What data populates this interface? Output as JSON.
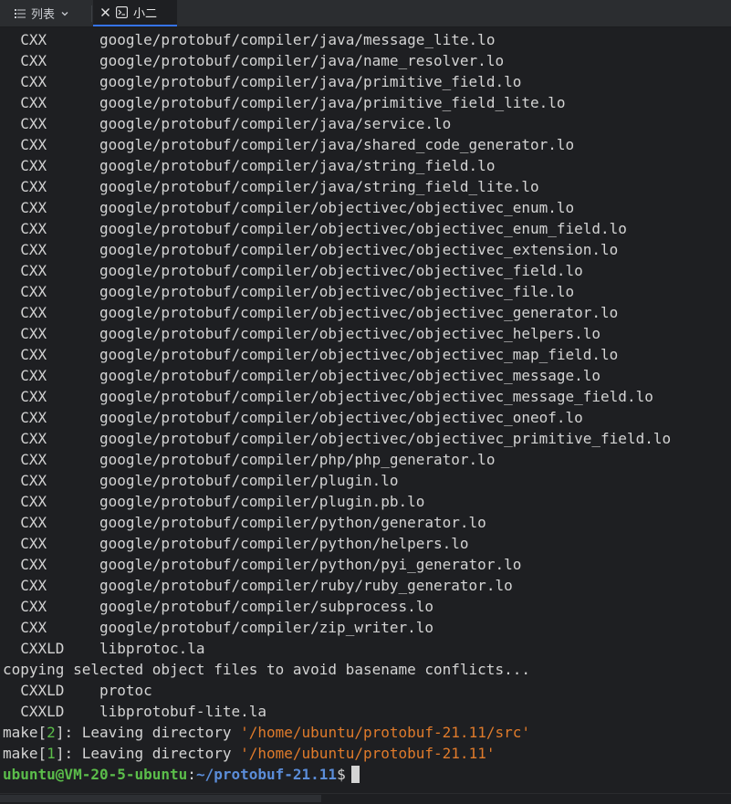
{
  "tabs": {
    "list_label": "列表",
    "active_label": "小二"
  },
  "colors": {
    "background": "#1e1f22",
    "text": "#d4d4d4",
    "orange": "#e07b2b",
    "green": "#5bbd4a",
    "blue": "#5b8dd9"
  },
  "build_lines": [
    {
      "tool": "CXX",
      "path": "google/protobuf/compiler/java/message_lite.lo"
    },
    {
      "tool": "CXX",
      "path": "google/protobuf/compiler/java/name_resolver.lo"
    },
    {
      "tool": "CXX",
      "path": "google/protobuf/compiler/java/primitive_field.lo"
    },
    {
      "tool": "CXX",
      "path": "google/protobuf/compiler/java/primitive_field_lite.lo"
    },
    {
      "tool": "CXX",
      "path": "google/protobuf/compiler/java/service.lo"
    },
    {
      "tool": "CXX",
      "path": "google/protobuf/compiler/java/shared_code_generator.lo"
    },
    {
      "tool": "CXX",
      "path": "google/protobuf/compiler/java/string_field.lo"
    },
    {
      "tool": "CXX",
      "path": "google/protobuf/compiler/java/string_field_lite.lo"
    },
    {
      "tool": "CXX",
      "path": "google/protobuf/compiler/objectivec/objectivec_enum.lo"
    },
    {
      "tool": "CXX",
      "path": "google/protobuf/compiler/objectivec/objectivec_enum_field.lo"
    },
    {
      "tool": "CXX",
      "path": "google/protobuf/compiler/objectivec/objectivec_extension.lo"
    },
    {
      "tool": "CXX",
      "path": "google/protobuf/compiler/objectivec/objectivec_field.lo"
    },
    {
      "tool": "CXX",
      "path": "google/protobuf/compiler/objectivec/objectivec_file.lo"
    },
    {
      "tool": "CXX",
      "path": "google/protobuf/compiler/objectivec/objectivec_generator.lo"
    },
    {
      "tool": "CXX",
      "path": "google/protobuf/compiler/objectivec/objectivec_helpers.lo"
    },
    {
      "tool": "CXX",
      "path": "google/protobuf/compiler/objectivec/objectivec_map_field.lo"
    },
    {
      "tool": "CXX",
      "path": "google/protobuf/compiler/objectivec/objectivec_message.lo"
    },
    {
      "tool": "CXX",
      "path": "google/protobuf/compiler/objectivec/objectivec_message_field.lo"
    },
    {
      "tool": "CXX",
      "path": "google/protobuf/compiler/objectivec/objectivec_oneof.lo"
    },
    {
      "tool": "CXX",
      "path": "google/protobuf/compiler/objectivec/objectivec_primitive_field.lo"
    },
    {
      "tool": "CXX",
      "path": "google/protobuf/compiler/php/php_generator.lo"
    },
    {
      "tool": "CXX",
      "path": "google/protobuf/compiler/plugin.lo"
    },
    {
      "tool": "CXX",
      "path": "google/protobuf/compiler/plugin.pb.lo"
    },
    {
      "tool": "CXX",
      "path": "google/protobuf/compiler/python/generator.lo"
    },
    {
      "tool": "CXX",
      "path": "google/protobuf/compiler/python/helpers.lo"
    },
    {
      "tool": "CXX",
      "path": "google/protobuf/compiler/python/pyi_generator.lo"
    },
    {
      "tool": "CXX",
      "path": "google/protobuf/compiler/ruby/ruby_generator.lo"
    },
    {
      "tool": "CXX",
      "path": "google/protobuf/compiler/subprocess.lo"
    },
    {
      "tool": "CXX",
      "path": "google/protobuf/compiler/zip_writer.lo"
    },
    {
      "tool": "CXXLD",
      "path": "libprotoc.la"
    }
  ],
  "copy_message": "copying selected object files to avoid basename conflicts...",
  "link_lines": [
    {
      "tool": "CXXLD",
      "path": "protoc"
    },
    {
      "tool": "CXXLD",
      "path": "libprotobuf-lite.la"
    }
  ],
  "make_lines": [
    {
      "prefix": "make",
      "level": "2",
      "text": ": Leaving directory ",
      "dir": "'/home/ubuntu/protobuf-21.11/src'"
    },
    {
      "prefix": "make",
      "level": "1",
      "text": ": Leaving directory ",
      "dir": "'/home/ubuntu/protobuf-21.11'"
    }
  ],
  "prompt": {
    "user_host": "ubuntu@VM-20-5-ubuntu",
    "colon": ":",
    "cwd": "~/protobuf-21.11",
    "symbol": "$"
  }
}
